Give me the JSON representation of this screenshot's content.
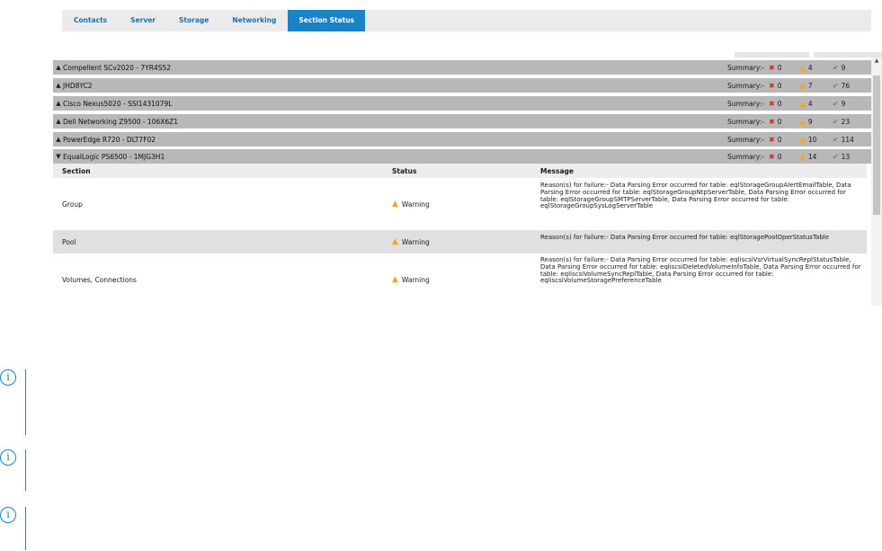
{
  "tabs": [
    {
      "label": "Contacts",
      "active": false
    },
    {
      "label": "Server",
      "active": false
    },
    {
      "label": "Storage",
      "active": false
    },
    {
      "label": "Networking",
      "active": false
    },
    {
      "label": "Section Status",
      "active": true
    }
  ],
  "summary_label": "Summary:-",
  "devices": [
    {
      "name": "Compellent SCv2020 - 7YR4S52",
      "expanded": false,
      "errors": "0",
      "warnings": "4",
      "ok": "9"
    },
    {
      "name": "JHD8YC2",
      "expanded": false,
      "errors": "0",
      "warnings": "7",
      "ok": "76"
    },
    {
      "name": "Cisco Nexus5020 - SSI1431079L",
      "expanded": false,
      "errors": "0",
      "warnings": "4",
      "ok": "9"
    },
    {
      "name": "Dell Networking Z9500 - 106X6Z1",
      "expanded": false,
      "errors": "0",
      "warnings": "9",
      "ok": "23"
    },
    {
      "name": "PowerEdge R720 - DLT7F02",
      "expanded": false,
      "errors": "0",
      "warnings": "10",
      "ok": "114"
    },
    {
      "name": "EqualLogic PS6500 - 1MJG3H1",
      "expanded": true,
      "errors": "0",
      "warnings": "14",
      "ok": "13"
    }
  ],
  "table": {
    "headers": {
      "section": "Section",
      "status": "Status",
      "message": "Message"
    },
    "rows": [
      {
        "section": "Group",
        "status": "Warning",
        "message": "Reason(s) for failure:- Data Parsing Error occurred for table: eqlStorageGroupAlertEmailTable, Data Parsing Error occurred for table: eqlStorageGroupNtpServerTable, Data Parsing Error occurred for table: eqlStorageGroupSMTPServerTable, Data Parsing Error occurred for table: eqlStorageGroupSysLogServerTable"
      },
      {
        "section": "Pool",
        "status": "Warning",
        "message": "Reason(s) for failure:- Data Parsing Error occurred for table: eqlStoragePoolOperStatusTable"
      },
      {
        "section": "Volumes, Connections",
        "status": "Warning",
        "message": "Reason(s) for failure:- Data Parsing Error occurred for table: eqliscsiVsrVirtualSyncReplStatusTable, Data Parsing Error occurred for table: eqliscsiDeletedVolumeInfoTable, Data Parsing Error occurred for table: eqliscsiVolumeSyncReplTable, Data Parsing Error occurred for table: eqliscsiVolumeStoragePreferenceTable"
      }
    ]
  },
  "colors": {
    "accent": "#1a82c5",
    "error": "#d42a2a",
    "warning": "#f3a51b",
    "ok": "#3aa935"
  },
  "icons": {
    "info": "info-icon",
    "error": "x-icon",
    "warning": "warning-triangle-icon",
    "ok": "check-icon"
  }
}
